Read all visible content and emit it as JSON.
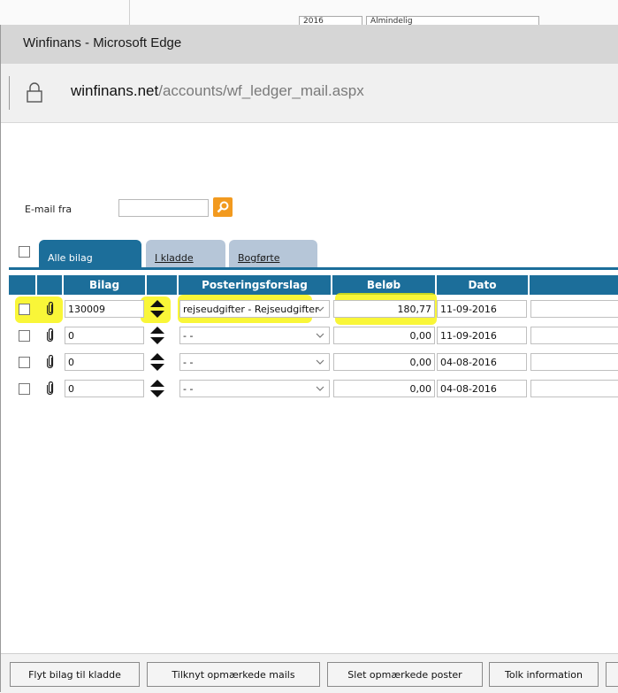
{
  "background": {
    "year_select": "2016",
    "type_select": "Almindelig"
  },
  "window": {
    "title": "Winfinans - Microsoft Edge"
  },
  "address": {
    "host": "winfinans.net",
    "path": "/accounts/wf_ledger_mail.aspx"
  },
  "filter": {
    "email_label": "E-mail fra",
    "email_value": "",
    "search_icon": "search-icon"
  },
  "tabs": [
    {
      "label": "Alle bilag",
      "active": true
    },
    {
      "label": "I kladde",
      "active": false
    },
    {
      "label": "Bogførte",
      "active": false
    }
  ],
  "table": {
    "headers": {
      "bilag": "Bilag",
      "forslag": "Posteringsforslag",
      "belob": "Beløb",
      "dato": "Dato"
    },
    "rows": [
      {
        "bilag": "130009",
        "forslag": "rejseudgifter - Rejseudgifter",
        "belob": "180,77",
        "dato": "11-09-2016",
        "highlighted": true
      },
      {
        "bilag": "0",
        "forslag": "- -",
        "belob": "0,00",
        "dato": "11-09-2016",
        "highlighted": false
      },
      {
        "bilag": "0",
        "forslag": "- -",
        "belob": "0,00",
        "dato": "04-08-2016",
        "highlighted": false
      },
      {
        "bilag": "0",
        "forslag": "- -",
        "belob": "0,00",
        "dato": "04-08-2016",
        "highlighted": false
      }
    ]
  },
  "footer": {
    "buttons": [
      "Flyt bilag til kladde",
      "Tilknyt opmærkede mails",
      "Slet opmærkede poster",
      "Tolk information"
    ]
  },
  "colors": {
    "accent": "#1c6e9a",
    "tab_inactive": "#b6c6d8",
    "highlight": "#f7f300",
    "search_button": "#f29a1f"
  }
}
